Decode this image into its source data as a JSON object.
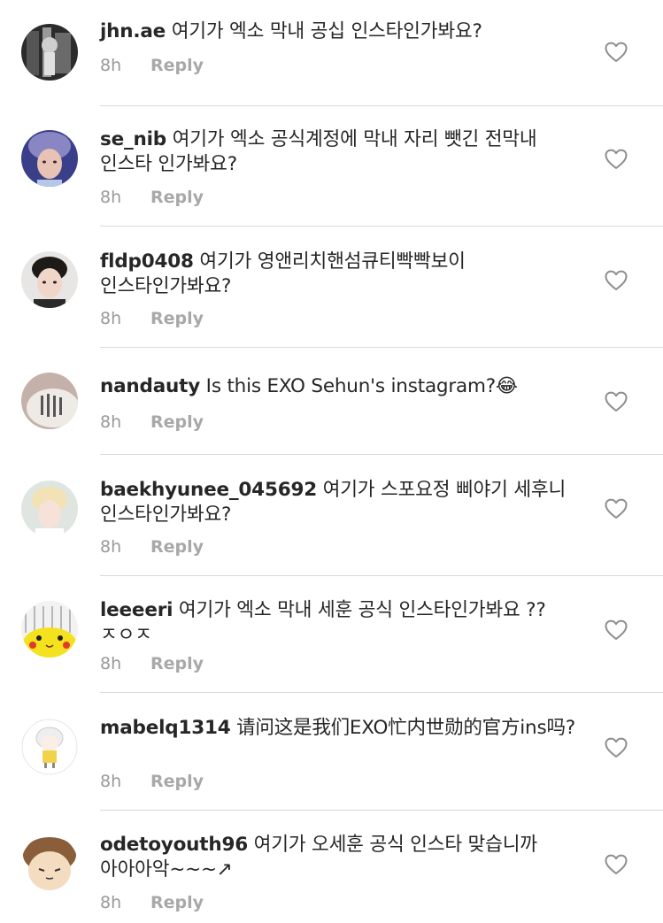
{
  "comments": [
    {
      "username": "jhn.ae",
      "text": "여기가 엑소 막내 공십 인스타인가봐요?",
      "time": "8h",
      "reply_label": "Reply",
      "avatar": "dark-photo-avatar"
    },
    {
      "username": "se_nib",
      "text": "여기가 엑소 공식계정에 막내 자리 뺏긴 전막내 인스타 인가봐요?",
      "time": "8h",
      "reply_label": "Reply",
      "avatar": "blue-hair-photo-avatar"
    },
    {
      "username": "fldp0408",
      "text": "여기가 영앤리치핸섬큐티빡빡보이 인스타인가봐요?",
      "time": "8h",
      "reply_label": "Reply",
      "avatar": "portrait-photo-avatar"
    },
    {
      "username": "nandauty",
      "text": "Is this EXO Sehun's instagram?😂",
      "time": "8h",
      "reply_label": "Reply",
      "avatar": "tattoo-photo-avatar"
    },
    {
      "username": "baekhyunee_045692",
      "text": "여기가 스포요정 삐야기 세후니 인스타인가봐요?",
      "time": "8h",
      "reply_label": "Reply",
      "avatar": "blonde-photo-avatar"
    },
    {
      "username": "leeeeri",
      "text": "여기가 엑소 막내 세훈 공식 인스타인가봐요 ??ㅈㅇㅈ",
      "time": "8h",
      "reply_label": "Reply",
      "avatar": "pikachu-avatar"
    },
    {
      "username": "mabelq1314",
      "text": "请问这是我们EXO忙内世勋的官方ins吗?",
      "time": "8h",
      "reply_label": "Reply",
      "avatar": "chibi-drawing-avatar"
    },
    {
      "username": "odetoyouth96",
      "text": "여기가 오세훈 공식 인스타 맞습니까 아아아악~~~↗",
      "time": "8h",
      "reply_label": "Reply",
      "avatar": "cute-face-avatar"
    }
  ],
  "icons": {
    "like": "heart-outline-icon"
  },
  "colors": {
    "text": "#262626",
    "meta": "#999999",
    "divider": "#dbdbdb",
    "heart": "#8e8e8e"
  }
}
